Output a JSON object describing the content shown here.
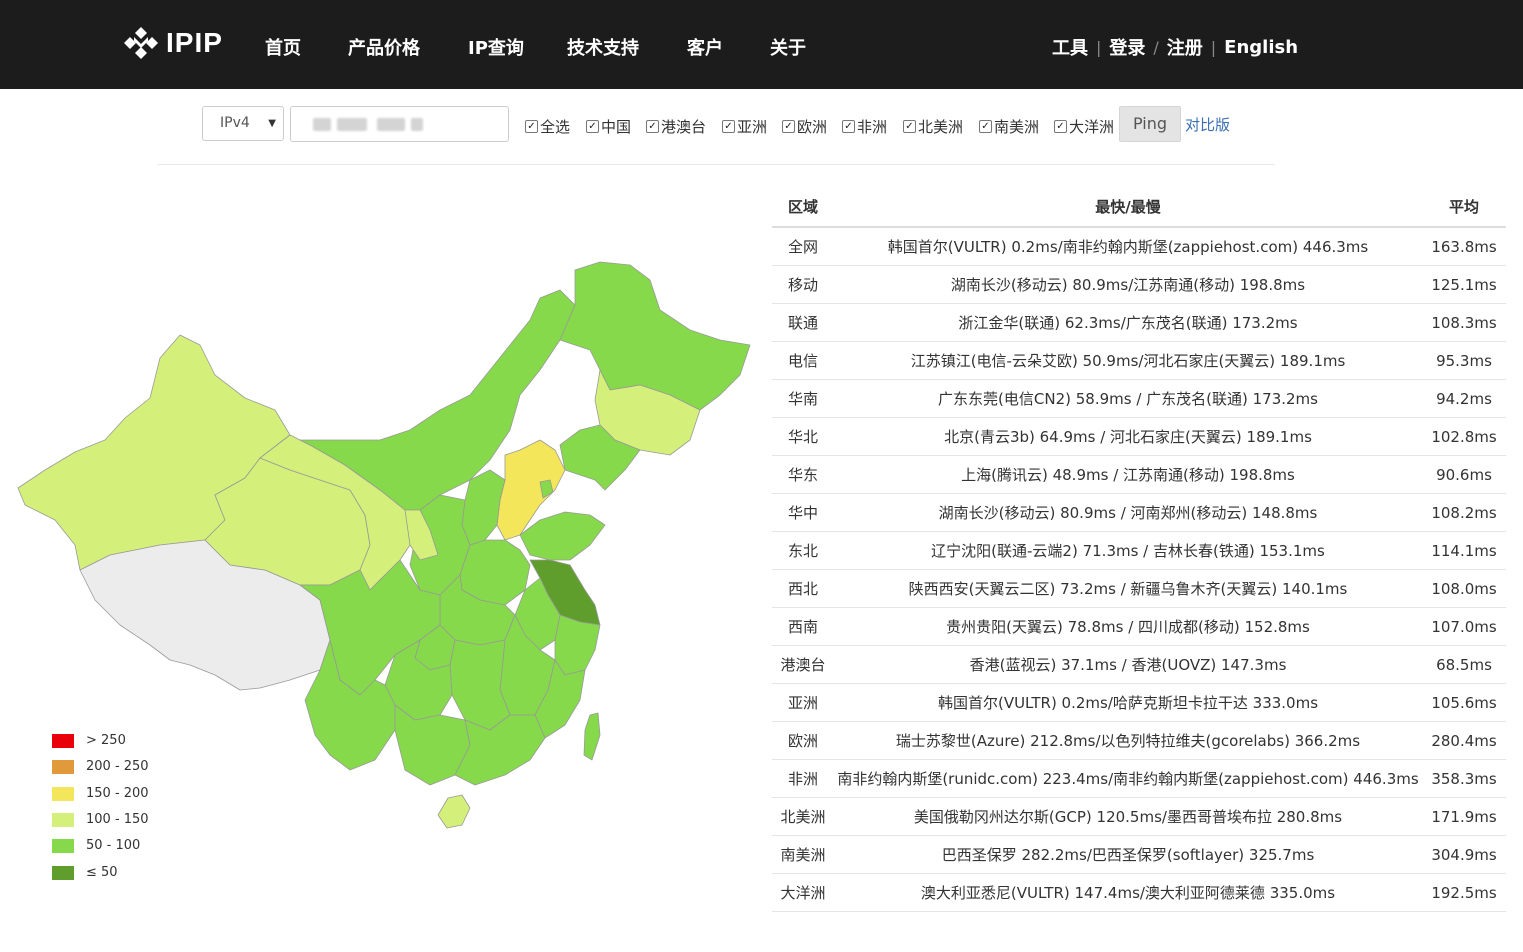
{
  "header": {
    "logo_text": "IPIP",
    "nav": [
      "首页",
      "产品价格",
      "IP查询",
      "技术支持",
      "客户",
      "关于"
    ],
    "right_nav": [
      "工具",
      "登录",
      "注册",
      "English"
    ],
    "right_sep": [
      "|",
      "/",
      "|"
    ]
  },
  "toolbar": {
    "ip_version": "IPv4",
    "caret": "▼",
    "checkmark": "✓",
    "checkboxes": [
      "全选",
      "中国",
      "港澳台",
      "亚洲",
      "欧洲",
      "非洲",
      "北美洲",
      "南美洲",
      "大洋洲"
    ],
    "ping_label": "Ping",
    "compare_label": "对比版"
  },
  "legend": [
    {
      "label": "> 250",
      "color": "#e8000b"
    },
    {
      "label": "200 - 250",
      "color": "#e09a3c"
    },
    {
      "label": "150 - 200",
      "color": "#f3e65a"
    },
    {
      "label": "100 - 150",
      "color": "#d4f07a"
    },
    {
      "label": "50 - 100",
      "color": "#86d94a"
    },
    {
      "label": "≤ 50",
      "color": "#5f9e2c"
    }
  ],
  "map_colors": {
    "lime": "#d4f07a",
    "green": "#86d94a",
    "yellow": "#f3e65a",
    "dark": "#5f9e2c",
    "gray": "#ececec",
    "border": "#999999"
  },
  "table": {
    "headers": [
      "区域",
      "最快/最慢",
      "平均"
    ],
    "rows": [
      [
        "全网",
        "韩国首尔(VULTR) 0.2ms/南非约翰内斯堡(zappiehost.com) 446.3ms",
        "163.8ms"
      ],
      [
        "移动",
        "湖南长沙(移动云) 80.9ms/江苏南通(移动) 198.8ms",
        "125.1ms"
      ],
      [
        "联通",
        "浙江金华(联通) 62.3ms/广东茂名(联通) 173.2ms",
        "108.3ms"
      ],
      [
        "电信",
        "江苏镇江(电信-云朵艾欧) 50.9ms/河北石家庄(天翼云) 189.1ms",
        "95.3ms"
      ],
      [
        "华南",
        "广东东莞(电信CN2) 58.9ms / 广东茂名(联通) 173.2ms",
        "94.2ms"
      ],
      [
        "华北",
        "北京(青云3b) 64.9ms / 河北石家庄(天翼云) 189.1ms",
        "102.8ms"
      ],
      [
        "华东",
        "上海(腾讯云) 48.9ms / 江苏南通(移动) 198.8ms",
        "90.6ms"
      ],
      [
        "华中",
        "湖南长沙(移动云) 80.9ms / 河南郑州(移动云) 148.8ms",
        "108.2ms"
      ],
      [
        "东北",
        "辽宁沈阳(联通-云端2) 71.3ms / 吉林长春(铁通) 153.1ms",
        "114.1ms"
      ],
      [
        "西北",
        "陕西西安(天翼云二区) 73.2ms / 新疆乌鲁木齐(天翼云) 140.1ms",
        "108.0ms"
      ],
      [
        "西南",
        "贵州贵阳(天翼云) 78.8ms / 四川成都(移动) 152.8ms",
        "107.0ms"
      ],
      [
        "港澳台",
        "香港(蓝视云) 37.1ms / 香港(UOVZ) 147.3ms",
        "68.5ms"
      ],
      [
        "亚洲",
        "韩国首尔(VULTR) 0.2ms/哈萨克斯坦卡拉干达 333.0ms",
        "105.6ms"
      ],
      [
        "欧洲",
        "瑞士苏黎世(Azure) 212.8ms/以色列特拉维夫(gcorelabs) 366.2ms",
        "280.4ms"
      ],
      [
        "非洲",
        "南非约翰内斯堡(runidc.com) 223.4ms/南非约翰内斯堡(zappiehost.com) 446.3ms",
        "358.3ms"
      ],
      [
        "北美洲",
        "美国俄勒冈州达尔斯(GCP) 120.5ms/墨西哥普埃布拉 280.8ms",
        "171.9ms"
      ],
      [
        "南美洲",
        "巴西圣保罗 282.2ms/巴西圣保罗(softlayer) 325.7ms",
        "304.9ms"
      ],
      [
        "大洋洲",
        "澳大利亚悉尼(VULTR) 147.4ms/澳大利亚阿德莱德 335.0ms",
        "192.5ms"
      ]
    ]
  }
}
